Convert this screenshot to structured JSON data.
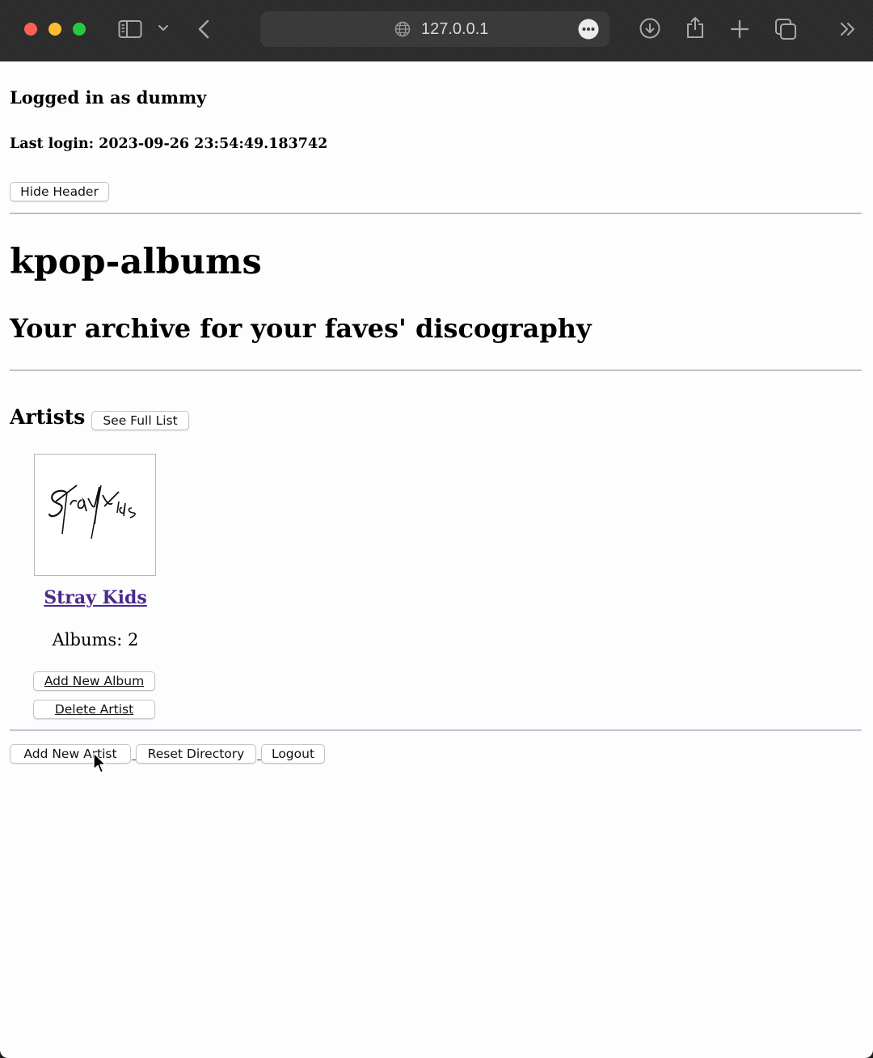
{
  "browser": {
    "url": "127.0.0.1",
    "colors": {
      "close": "#fe5f57",
      "minimize": "#febc2e",
      "zoom": "#28c840"
    }
  },
  "header": {
    "logged_in_text": "Logged in as dummy",
    "last_login_text": "Last login: 2023-09-26 23:54:49.183742",
    "hide_header_label": "Hide Header"
  },
  "site": {
    "title": "kpop-albums",
    "tagline": "Your archive for your faves' discography"
  },
  "artists_section": {
    "heading": "Artists",
    "see_full_list_label": "See Full List",
    "artists": [
      {
        "name": "Stray Kids",
        "logo_text": "Stray Kids",
        "albums_text": "Albums: 2",
        "add_album_label": "Add New Album",
        "delete_label": "Delete Artist"
      }
    ]
  },
  "footer": {
    "add_artist_label": "Add New Artist",
    "reset_label": "Reset Directory",
    "logout_label": "Logout"
  }
}
